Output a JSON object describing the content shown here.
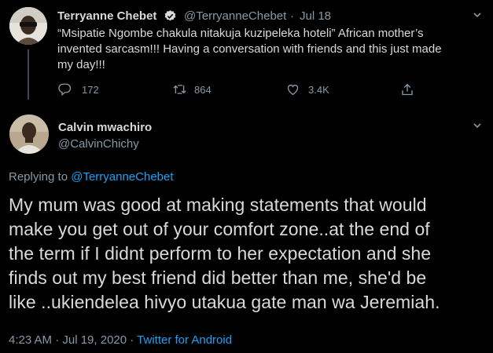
{
  "parent_tweet": {
    "author_name": "Terryanne Chebet",
    "handle": "@TerryanneChebet",
    "separator": "·",
    "date": "Jul 18",
    "text_lines": [
      "“Msipatie Ngombe chakula nitakuja kuzipeleka hoteli” African mother’s",
      "invented sarcasm!!!  Having a conversation with friends and this just made",
      "my day!!!"
    ],
    "replies": "172",
    "retweets": "864",
    "likes": "3.4K"
  },
  "main_tweet": {
    "author_name": "Calvin mwachiro",
    "handle": "@CalvinChichy",
    "replying_prefix": "Replying to ",
    "replying_to": "@TerryanneChebet",
    "text_lines": [
      "My mum was good at making statements that would",
      "make you get out of your comfort zone..at the end of",
      "the term if I didnt perform to her expectation and she",
      "finds out my best friend did better than me, she'd be",
      "like ..ukiendelea hivyo utakua gate man wa Jeremiah."
    ],
    "timestamp": "4:23 AM · Jul 19, 2020",
    "dot": " · ",
    "source": "Twitter for Android"
  },
  "icons": {
    "verified": "verified-badge-icon",
    "chevron": "chevron-down-icon",
    "reply": "reply-icon",
    "retweet": "retweet-icon",
    "like": "heart-icon",
    "share": "share-icon"
  },
  "colors": {
    "background": "#000000",
    "text": "#d9d9d9",
    "muted": "#8899a6",
    "link": "#1da1f2",
    "thread_line": "#3d4a55"
  }
}
